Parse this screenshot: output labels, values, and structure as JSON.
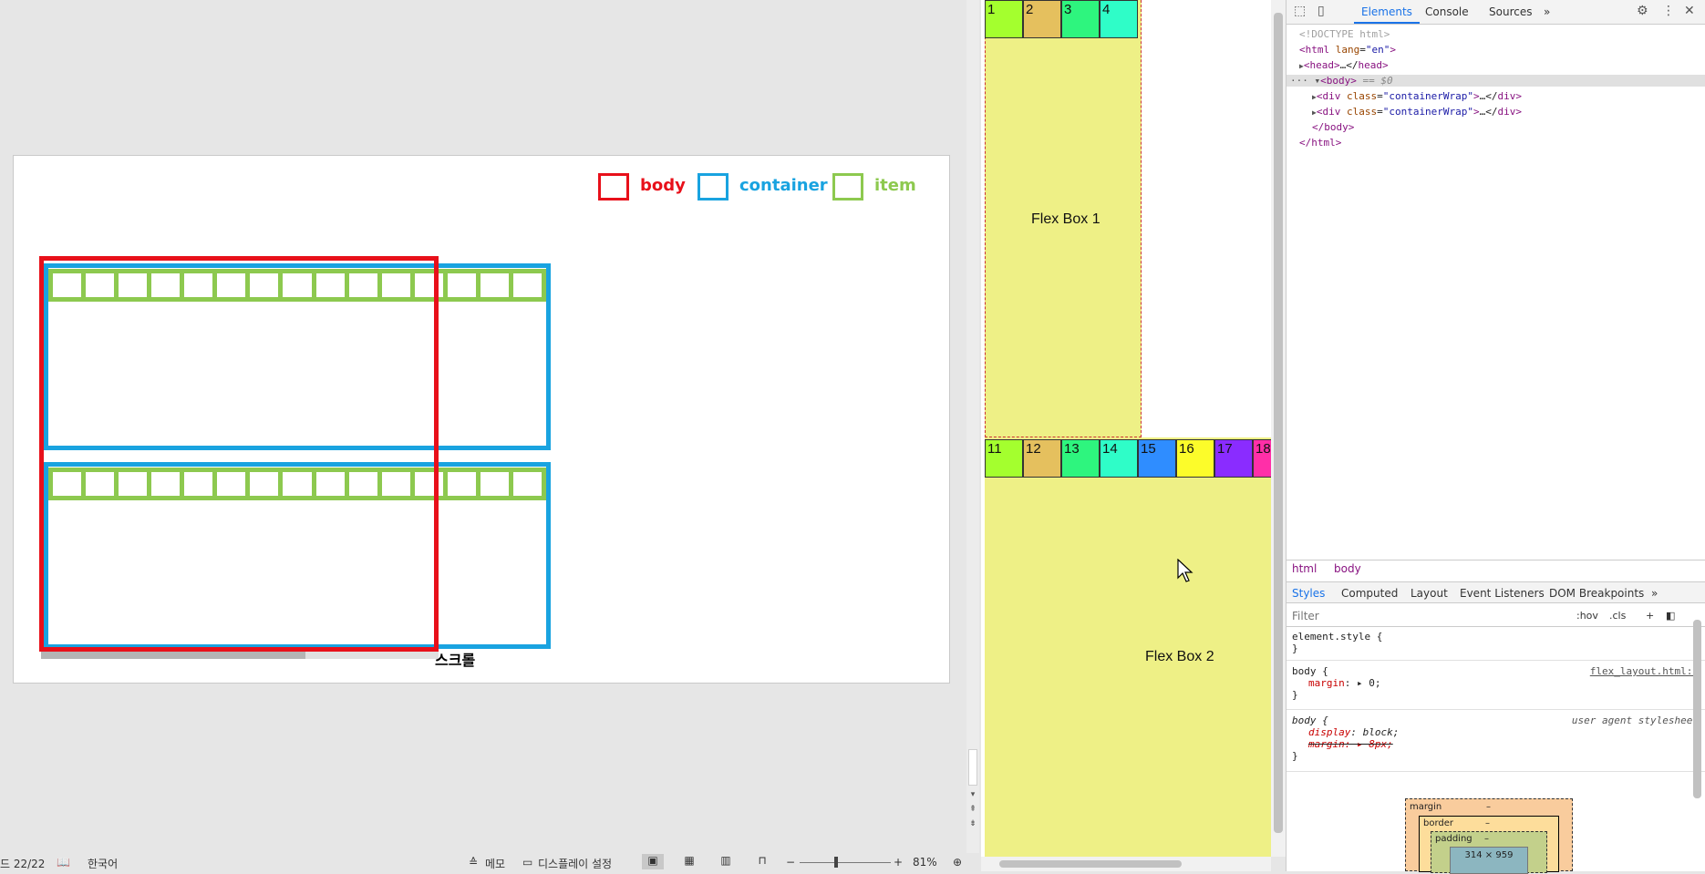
{
  "slide": {
    "legend": [
      {
        "label": "body",
        "color": "#e8101a"
      },
      {
        "label": "container",
        "color": "#19a3e0"
      },
      {
        "label": "item",
        "color": "#8dc94f"
      }
    ],
    "item_cells": 15,
    "scroll_label": "스크롤"
  },
  "statusbar": {
    "slide_counter": "드 22/22",
    "language": "한국어",
    "memo": "메모",
    "display_settings": "디스플레이 설정",
    "zoom_minus": "−",
    "zoom_plus": "+",
    "zoom_level": "81%"
  },
  "viewport": {
    "box1": {
      "label": "Flex Box 1",
      "items": [
        {
          "n": "1",
          "color": "#a4ff2e"
        },
        {
          "n": "2",
          "color": "#e5c05e"
        },
        {
          "n": "3",
          "color": "#2ef57e"
        },
        {
          "n": "4",
          "color": "#2ffdc8"
        }
      ]
    },
    "box2": {
      "label": "Flex Box 2",
      "items": [
        {
          "n": "11",
          "color": "#a4ff2e"
        },
        {
          "n": "12",
          "color": "#e5c05e"
        },
        {
          "n": "13",
          "color": "#2ef57e"
        },
        {
          "n": "14",
          "color": "#2ffdc8"
        },
        {
          "n": "15",
          "color": "#2f8dff"
        },
        {
          "n": "16",
          "color": "#fcfc2a"
        },
        {
          "n": "17",
          "color": "#8a2cff"
        },
        {
          "n": "18",
          "color": "#ff2fa8"
        }
      ]
    }
  },
  "devtools": {
    "tabs": [
      "Elements",
      "Console",
      "Sources",
      "»"
    ],
    "dom": {
      "doctype": "<!DOCTYPE html>",
      "html_open_tag": "html",
      "html_attr": "lang",
      "html_attr_val": "\"en\"",
      "head": "head",
      "head_ellipsis": "…</",
      "head_close": "head>",
      "body_tag": "body",
      "body_hint": "== $0",
      "div_tag": "div",
      "div_attr": "class",
      "div_val": "\"containerWrap\"",
      "div_ellipsis": "…</",
      "div_close": "div>",
      "body_close": "</body>",
      "html_close": "</html>"
    },
    "crumbs": [
      "html",
      "body"
    ],
    "styles_tabs": [
      "Styles",
      "Computed",
      "Layout",
      "Event Listeners",
      "DOM Breakpoints",
      "»"
    ],
    "filter_placeholder": "Filter",
    "hov": ":hov",
    "cls": ".cls",
    "rules": {
      "element_style": "element.style {",
      "close": "}",
      "body_sel": "body {",
      "body_src": "flex_layout.html:8",
      "body_prop": "margin",
      "body_val": ": ▸ 0;",
      "ua_sel": "body {",
      "ua_src": "user agent stylesheet",
      "ua_prop1": "display",
      "ua_val1": ": block;",
      "ua_prop2": "margin: ▸ 8px;"
    },
    "boxmodel": {
      "margin": "margin",
      "border": "border",
      "padding": "padding",
      "dash": "–",
      "content": "314 × 959"
    }
  }
}
